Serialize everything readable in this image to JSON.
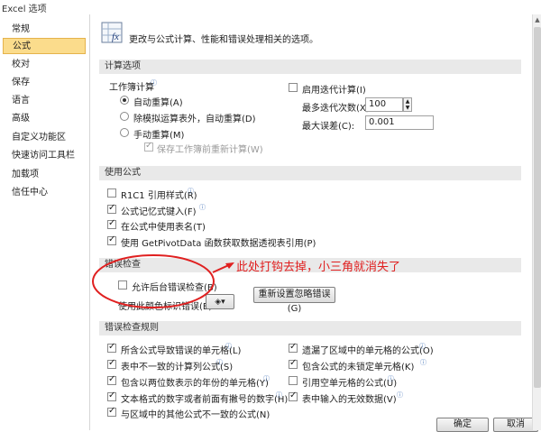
{
  "window": {
    "title": "Excel 选项"
  },
  "sidebar": {
    "items": [
      {
        "label": "常规"
      },
      {
        "label": "公式",
        "selected": true
      },
      {
        "label": "校对"
      },
      {
        "label": "保存"
      },
      {
        "label": "语言"
      },
      {
        "label": "高级"
      },
      {
        "label": "自定义功能区"
      },
      {
        "label": "快速访问工具栏"
      },
      {
        "label": "加载项"
      },
      {
        "label": "信任中心"
      }
    ]
  },
  "header": {
    "description": "更改与公式计算、性能和错误处理相关的选项。"
  },
  "calc": {
    "section": "计算选项",
    "workbook_calc": "工作簿计算",
    "auto": "自动重算(A)",
    "auto_except_tables": "除模拟运算表外，自动重算(D)",
    "manual": "手动重算(M)",
    "recalc_before_save": "保存工作簿前重新计算(W)",
    "enable_iterative": "启用迭代计算(I)",
    "max_iterations_label": "最多迭代次数(X):",
    "max_iterations": "100",
    "max_change_label": "最大误差(C):",
    "max_change": "0.001"
  },
  "formulas": {
    "section": "使用公式",
    "r1c1": "R1C1 引用样式(R)",
    "autocomplete": "公式记忆式键入(F)",
    "table_names": "在公式中使用表名(T)",
    "getpivotdata": "使用 GetPivotData 函数获取数据透视表引用(P)"
  },
  "error_checking": {
    "section": "错误检查",
    "background": "允许后台错误检查(B)",
    "indicator_label": "使用此颜色标识错误(E):",
    "reset_button": "重新设置忽略错误(G)"
  },
  "annotation": {
    "text": "此处打钩去掉，小三角就消失了"
  },
  "rules": {
    "section": "错误检查规则",
    "left": [
      {
        "label": "所含公式导致错误的单元格(L)",
        "checked": true
      },
      {
        "label": "表中不一致的计算列公式(S)",
        "checked": true
      },
      {
        "label": "包含以两位数表示的年份的单元格(Y)",
        "checked": true
      },
      {
        "label": "文本格式的数字或者前面有撇号的数字(H)",
        "checked": true
      },
      {
        "label": "与区域中的其他公式不一致的公式(N)",
        "checked": true
      }
    ],
    "right": [
      {
        "label": "遗漏了区域中的单元格的公式(O)",
        "checked": true
      },
      {
        "label": "包含公式的未锁定单元格(K)",
        "checked": true
      },
      {
        "label": "引用空单元格的公式(U)",
        "checked": false
      },
      {
        "label": "表中输入的无效数据(V)",
        "checked": true
      }
    ]
  },
  "footer": {
    "ok": "确定",
    "cancel": "取消"
  },
  "colors": {
    "selected_bg": "#fbdc8c",
    "annotation": "#e02020",
    "section_bg": "#e9e9e9"
  }
}
